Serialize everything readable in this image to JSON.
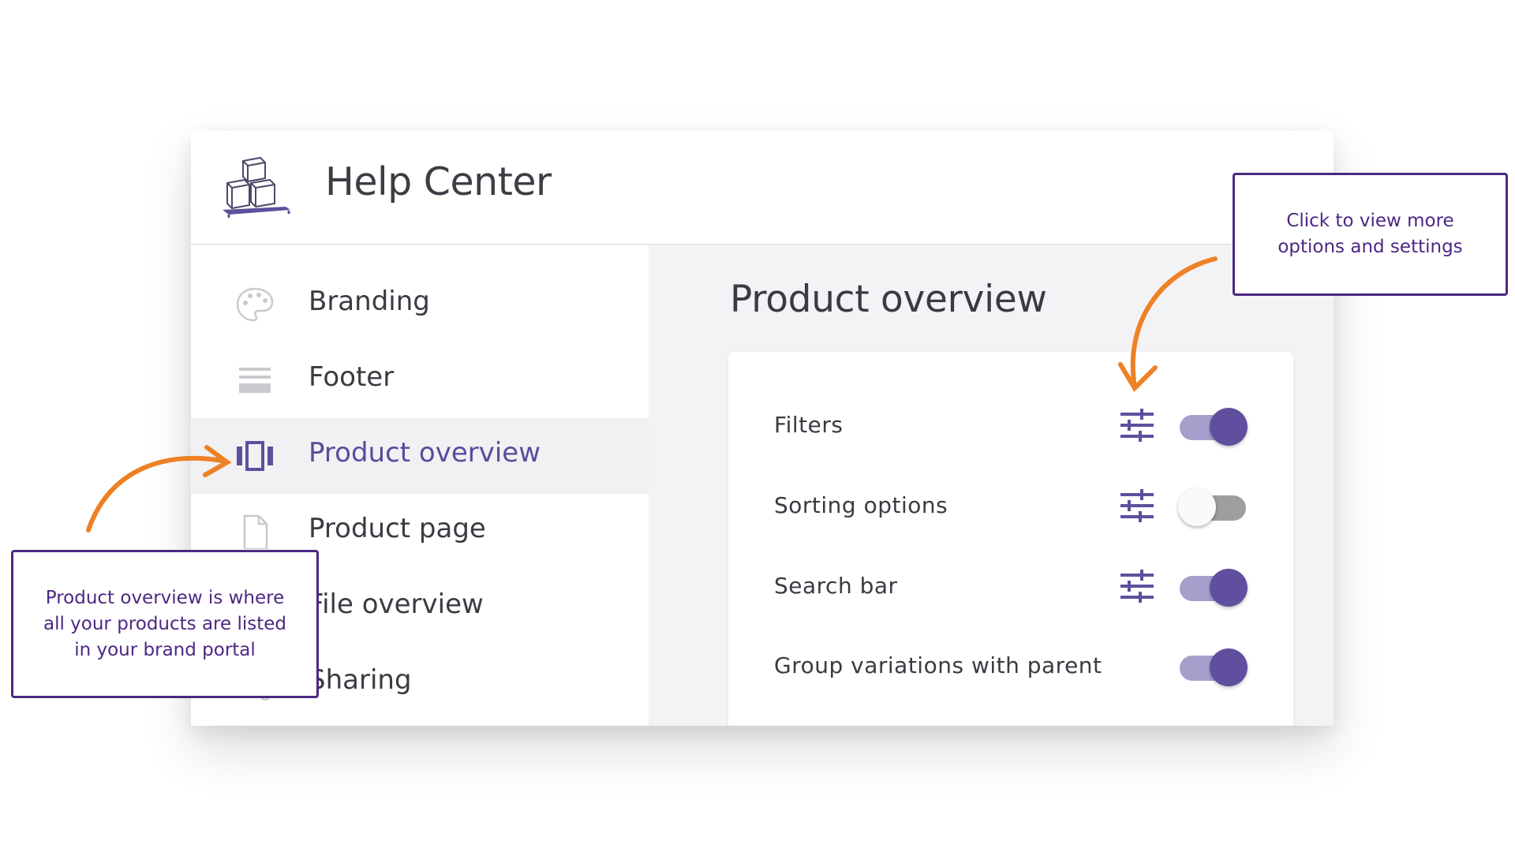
{
  "app": {
    "title": "Help Center",
    "logo_icon": "boxes-logo-icon"
  },
  "sidebar": {
    "items": [
      {
        "label": "Branding",
        "icon": "palette-icon",
        "active": false
      },
      {
        "label": "Footer",
        "icon": "footer-icon",
        "active": false
      },
      {
        "label": "Product overview",
        "icon": "carousel-icon",
        "active": true
      },
      {
        "label": "Product page",
        "icon": "file-icon",
        "active": false
      },
      {
        "label": "File overview",
        "icon": "folder-icon",
        "active": false
      },
      {
        "label": "Sharing",
        "icon": "share-icon",
        "active": false
      }
    ]
  },
  "main": {
    "title": "Product overview",
    "settings": [
      {
        "label": "Filters",
        "has_options": true,
        "enabled": true
      },
      {
        "label": "Sorting options",
        "has_options": true,
        "enabled": false
      },
      {
        "label": "Search bar",
        "has_options": true,
        "enabled": true
      },
      {
        "label": "Group variations with parent",
        "has_options": false,
        "enabled": true
      }
    ]
  },
  "annotations": {
    "options_note": "Click to view more options and settings",
    "overview_note": "Product overview is where all your products are listed in your brand portal"
  },
  "colors": {
    "accent": "#5f4f9e",
    "toggle_track_on": "#a79fcb",
    "toggle_track_off": "#9e9e9e",
    "arrow": "#ee8124",
    "callout_border": "#4c2882"
  }
}
